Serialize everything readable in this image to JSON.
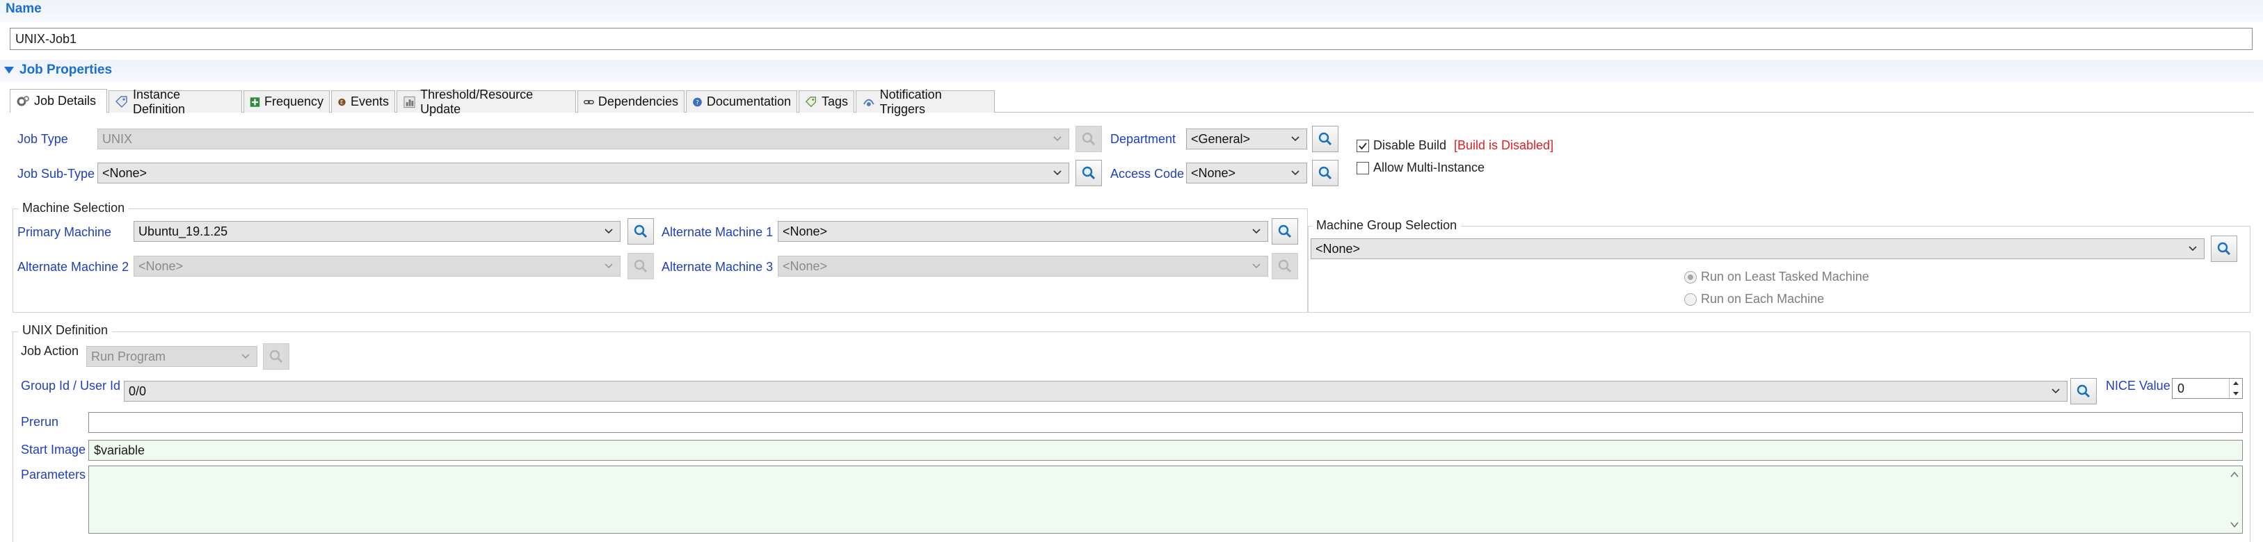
{
  "name_section": {
    "label": "Name",
    "value": "UNIX-Job1"
  },
  "job_properties": {
    "label": "Job Properties"
  },
  "tabs": [
    {
      "label": "Job Details",
      "icon": "gears-icon"
    },
    {
      "label": "Instance Definition",
      "icon": "tag-icon"
    },
    {
      "label": "Frequency",
      "icon": "plus-calendar-icon"
    },
    {
      "label": "Events",
      "icon": "events-icon"
    },
    {
      "label": "Threshold/Resource Update",
      "icon": "threshold-icon"
    },
    {
      "label": "Dependencies",
      "icon": "chain-icon"
    },
    {
      "label": "Documentation",
      "icon": "help-icon"
    },
    {
      "label": "Tags",
      "icon": "tag-icon"
    },
    {
      "label": "Notification Triggers",
      "icon": "notification-icon"
    }
  ],
  "job_details": {
    "job_type_label": "Job Type",
    "job_type_value": "UNIX",
    "job_subtype_label": "Job Sub-Type",
    "job_subtype_value": "<None>",
    "department_label": "Department",
    "department_value": "<General>",
    "access_code_label": "Access Code",
    "access_code_value": "<None>",
    "disable_build_label": "Disable Build",
    "disable_build_checked": true,
    "build_status": "[Build is Disabled]",
    "allow_multi_label": "Allow Multi-Instance",
    "allow_multi_checked": false
  },
  "machine_selection": {
    "title": "Machine Selection",
    "primary_label": "Primary Machine",
    "primary_value": "Ubuntu_19.1.25",
    "alt1_label": "Alternate Machine 1",
    "alt1_value": "<None>",
    "alt2_label": "Alternate Machine 2",
    "alt2_value": "<None>",
    "alt3_label": "Alternate Machine 3",
    "alt3_value": "<None>"
  },
  "machine_group": {
    "title": "Machine Group Selection",
    "value": "<None>",
    "radio_least": "Run on Least Tasked Machine",
    "radio_each": "Run on Each Machine"
  },
  "unix_definition": {
    "title": "UNIX Definition",
    "job_action_label": "Job Action",
    "job_action_value": "Run Program",
    "group_user_label": "Group Id / User Id",
    "group_user_value": "0/0",
    "nice_label": "NICE Value",
    "nice_value": "0",
    "prerun_label": "Prerun",
    "prerun_value": "",
    "start_image_label": "Start Image",
    "start_image_value": "$variable",
    "parameters_label": "Parameters",
    "parameters_value": ""
  },
  "colors": {
    "accent": "#1b6fd0",
    "label_blue": "#1f3fbf",
    "build_red": "#e02020",
    "green_field": "#eefbee"
  }
}
